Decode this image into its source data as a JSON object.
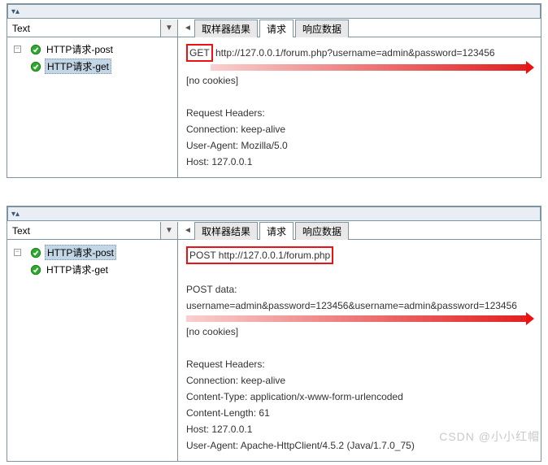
{
  "panels": [
    {
      "left_header": "Text",
      "tree": [
        {
          "label": "HTTP请求-post",
          "selected": false
        },
        {
          "label": "HTTP请求-get",
          "selected": true
        }
      ],
      "tabs": {
        "sampler": "取样器结果",
        "request": "请求",
        "response": "响应数据",
        "active": 1
      },
      "detail": {
        "method_highlight": "GET",
        "url_after": " http://127.0.0.1/forum.php?username=admin&password=123456",
        "arrow_top": true,
        "lines": [
          "",
          "[no cookies]",
          "",
          "Request Headers:",
          "Connection: keep-alive",
          "User-Agent: Mozilla/5.0",
          "Host: 127.0.0.1"
        ]
      }
    },
    {
      "left_header": "Text",
      "tree": [
        {
          "label": "HTTP请求-post",
          "selected": true
        },
        {
          "label": "HTTP请求-get",
          "selected": false
        }
      ],
      "tabs": {
        "sampler": "取样器结果",
        "request": "请求",
        "response": "响应数据",
        "active": 1
      },
      "detail": {
        "method_highlight": "POST http://127.0.0.1/forum.php",
        "url_after": "",
        "arrow_top": false,
        "post_label": "POST data:",
        "post_data": "username=admin&password=123456&username=admin&password=123456",
        "lines": [
          "",
          "[no cookies]",
          "",
          "Request Headers:",
          "Connection: keep-alive",
          "Content-Type: application/x-www-form-urlencoded",
          "Content-Length: 61",
          "Host: 127.0.0.1",
          "User-Agent: Apache-HttpClient/4.5.2 (Java/1.7.0_75)"
        ]
      }
    }
  ],
  "watermark": "CSDN @小小红帽"
}
